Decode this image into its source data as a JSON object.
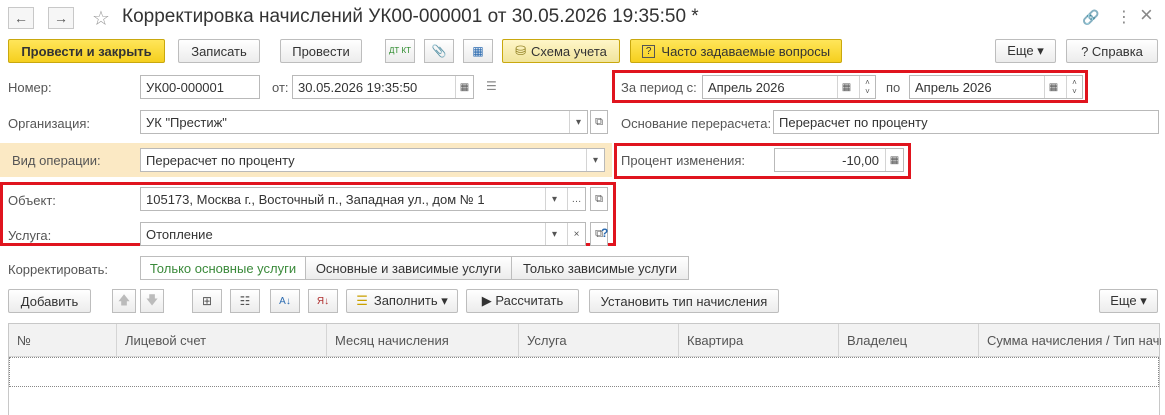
{
  "window": {
    "title": "Корректировка начислений УК00-000001 от 30.05.2026 19:35:50 *",
    "back_icon": "←",
    "forward_icon": "→",
    "star_icon": "☆",
    "link_icon": "🔗",
    "more_icon": "⋮",
    "close_icon": "×"
  },
  "toolbar": {
    "post_close": "Провести и закрыть",
    "save": "Записать",
    "post": "Провести",
    "dt_kt": "ДТ КТ",
    "attach_icon": "📎",
    "struct_icon": "▦",
    "scheme": "Схема учета",
    "faq": "Часто задаваемые вопросы",
    "more": "Еще ▾",
    "help": "? Справка"
  },
  "form": {
    "number_label": "Номер:",
    "number_value": "УК00-000001",
    "from_label": "от:",
    "date_value": "30.05.2026 19:35:50",
    "period_label": "За период с:",
    "period_from": "Апрель 2026",
    "period_to_label": "по",
    "period_to": "Апрель 2026",
    "org_label": "Организация:",
    "org_value": "УК \"Престиж\"",
    "basis_label": "Основание перерасчета:",
    "basis_value": "Перерасчет по проценту",
    "op_label": "Вид операции:",
    "op_value": "Перерасчет по проценту",
    "percent_label": "Процент изменения:",
    "percent_value": "-10,00",
    "object_label": "Объект:",
    "object_value": "105173, Москва г., Восточный п., Западная ул., дом № 1",
    "service_label": "Услуга:",
    "service_value": "Отопление",
    "correct_label": "Корректировать:",
    "seg_main": "Только основные услуги",
    "seg_main_dep": "Основные и зависимые услуги",
    "seg_dep": "Только зависимые услуги"
  },
  "table_toolbar": {
    "add": "Добавить",
    "fill": "Заполнить ▾",
    "calc": "▶ Рассчитать",
    "set_type": "Установить тип начисления",
    "more": "Еще ▾"
  },
  "table": {
    "columns": [
      "№",
      "Лицевой счет",
      "Месяц начисления",
      "Услуга",
      "Квартира",
      "Владелец",
      "Сумма начисления / Тип начисления"
    ]
  },
  "colors": {
    "accent_yellow": "#f5cf1e",
    "highlight_red": "#e0141e",
    "op_bg": "#fbe9c4"
  }
}
